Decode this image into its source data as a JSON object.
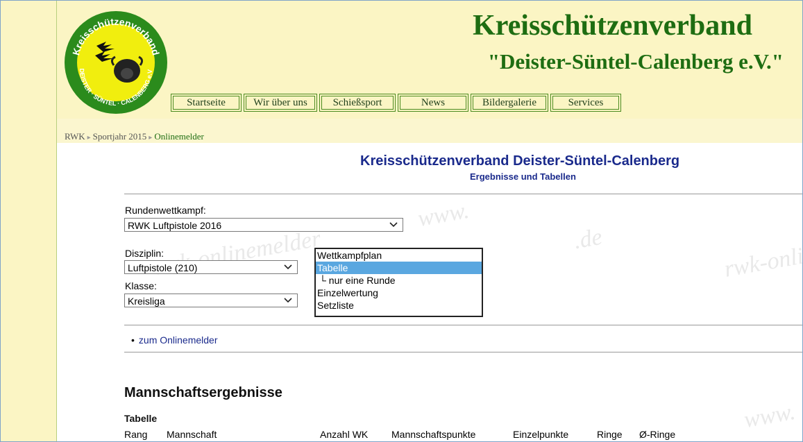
{
  "header": {
    "title": "Kreisschützenverband",
    "subtitle": "\"Deister-Süntel-Calenberg e.V.\"",
    "logo": {
      "ring_top": "Kreisschützenverband",
      "ring_bottom": "DEISTER · SÜNTEL · CALENBERG e.V."
    }
  },
  "nav": [
    "Startseite",
    "Wir über uns",
    "Schießsport",
    "News",
    "Bildergalerie",
    "Services"
  ],
  "breadcrumb": {
    "items": [
      "RWK",
      "Sportjahr 2015"
    ],
    "current": "Onlinemelder"
  },
  "content": {
    "heading": "Kreisschützenverband Deister-Süntel-Calenberg",
    "subheading": "Ergebnisse und Tabellen",
    "watermark": [
      "rwk-onlinemelder",
      "www.",
      ".de",
      "rwk-onlinemelder.de",
      "www."
    ],
    "form": {
      "rundenwettkampf_label": "Rundenwettkampf:",
      "rundenwettkampf_value": "RWK Luftpistole 2016",
      "disziplin_label": "Disziplin:",
      "disziplin_value": "Luftpistole (210)",
      "klasse_label": "Klasse:",
      "klasse_value": "Kreisliga",
      "listbox": [
        "Wettkampfplan",
        "Tabelle",
        "└ nur eine Runde",
        "Einzelwertung",
        "Setzliste"
      ],
      "listbox_selected": "Tabelle"
    },
    "link": "zum Onlinemelder",
    "results_heading": "Mannschaftsergebnisse",
    "table_heading": "Tabelle",
    "columns": [
      "Rang",
      "Mannschaft",
      "Anzahl WK",
      "Mannschaftspunkte",
      "Einzelpunkte",
      "Ringe",
      "Ø-Ringe"
    ]
  },
  "colors": {
    "brand_green": "#1e6d12",
    "heading_blue": "#1a2a8c",
    "selected_option": "#5aa7e0",
    "page_bg": "#fbf6cf"
  }
}
